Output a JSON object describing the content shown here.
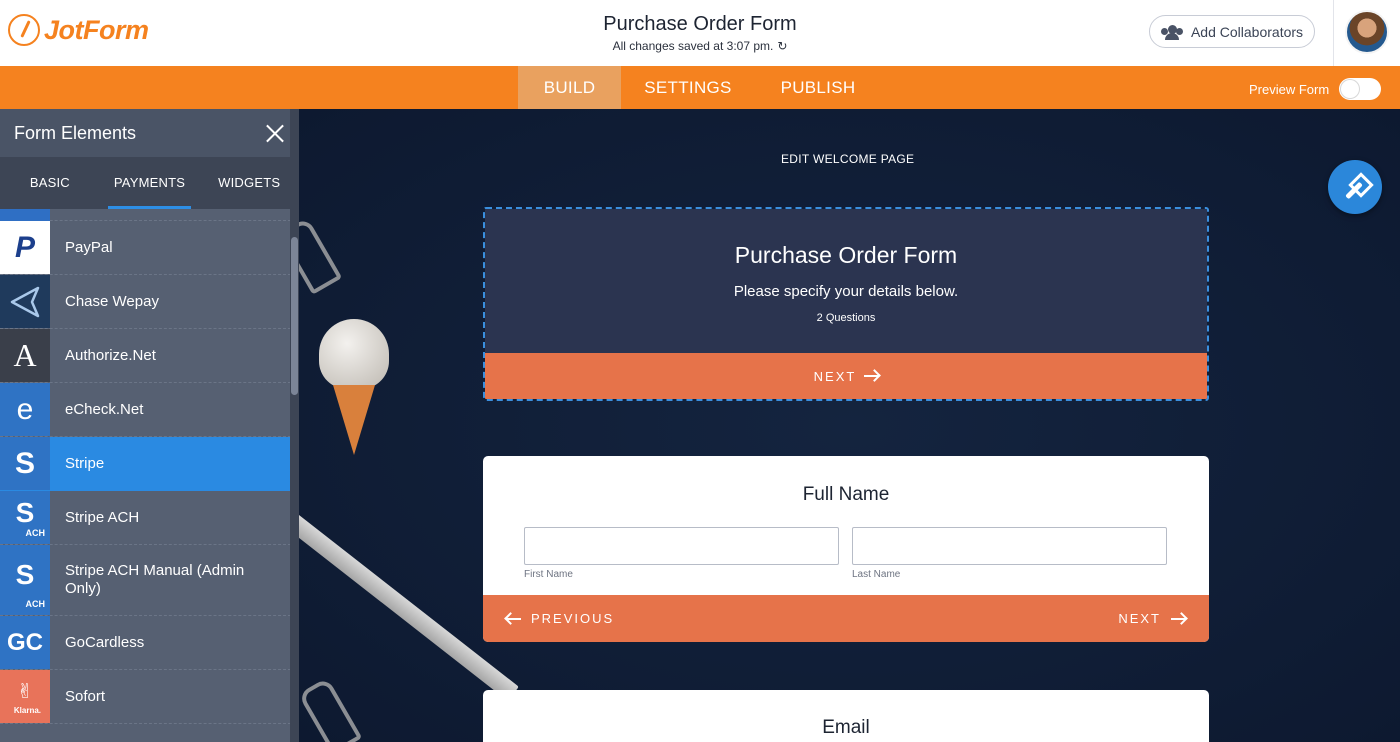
{
  "header": {
    "logo_text": "JotForm",
    "form_title": "Purchase Order Form",
    "save_status": "All changes saved at 3:07 pm.",
    "collaborators_label": "Add Collaborators"
  },
  "nav": {
    "tabs": [
      {
        "label": "BUILD",
        "active": true
      },
      {
        "label": "SETTINGS",
        "active": false
      },
      {
        "label": "PUBLISH",
        "active": false
      }
    ],
    "preview_label": "Preview Form"
  },
  "sidebar": {
    "title": "Form Elements",
    "tabs": [
      {
        "label": "BASIC",
        "active": false
      },
      {
        "label": "PAYMENTS",
        "active": true
      },
      {
        "label": "WIDGETS",
        "active": false
      }
    ],
    "items": [
      {
        "label": "PayPal",
        "icon": "paypal-icon",
        "icon_text": "P",
        "icon_bg": "#ffffff",
        "icon_color": "#1c3f8c"
      },
      {
        "label": "Chase Wepay",
        "icon": "chase-wepay-icon",
        "icon_text": "",
        "icon_bg": "#1f3a5c",
        "icon_color": "#a9c8ea"
      },
      {
        "label": "Authorize.Net",
        "icon": "authorize-net-icon",
        "icon_text": "A",
        "icon_bg": "#3a3f4a",
        "icon_color": "#ffffff"
      },
      {
        "label": "eCheck.Net",
        "icon": "echeck-icon",
        "icon_text": "e",
        "icon_bg": "#2f73c4",
        "icon_color": "#ffffff"
      },
      {
        "label": "Stripe",
        "icon": "stripe-icon",
        "icon_text": "S",
        "icon_bg": "#2f73c4",
        "icon_color": "#ffffff",
        "selected": true
      },
      {
        "label": "Stripe ACH",
        "icon": "stripe-ach-icon",
        "icon_text": "S",
        "icon_sub": "ACH",
        "icon_bg": "#2f73c4",
        "icon_color": "#ffffff"
      },
      {
        "label": "Stripe ACH Manual (Admin Only)",
        "icon": "stripe-ach-manual-icon",
        "icon_text": "S",
        "icon_sub": "ACH",
        "icon_bg": "#2f73c4",
        "icon_color": "#ffffff",
        "tall": true
      },
      {
        "label": "GoCardless",
        "icon": "gocardless-icon",
        "icon_text": "GC",
        "icon_bg": "#2f73c4",
        "icon_color": "#ffffff"
      },
      {
        "label": "Sofort",
        "icon": "sofort-icon",
        "icon_text": "✌",
        "icon_sub": "Klarna.",
        "icon_bg": "#e8735a",
        "icon_color": "#ffffff"
      }
    ]
  },
  "canvas": {
    "edit_welcome_label": "EDIT WELCOME PAGE",
    "welcome": {
      "title": "Purchase Order Form",
      "subtitle": "Please specify your details below.",
      "question_count": "2  Questions",
      "next_label": "NEXT"
    },
    "full_name": {
      "title": "Full Name",
      "first_label": "First Name",
      "last_label": "Last Name",
      "previous_label": "PREVIOUS",
      "next_label": "NEXT"
    },
    "email": {
      "title": "Email"
    }
  },
  "colors": {
    "brand_orange": "#f5821f",
    "accent_blue": "#2a8ae2",
    "button_coral": "#e6734a"
  }
}
